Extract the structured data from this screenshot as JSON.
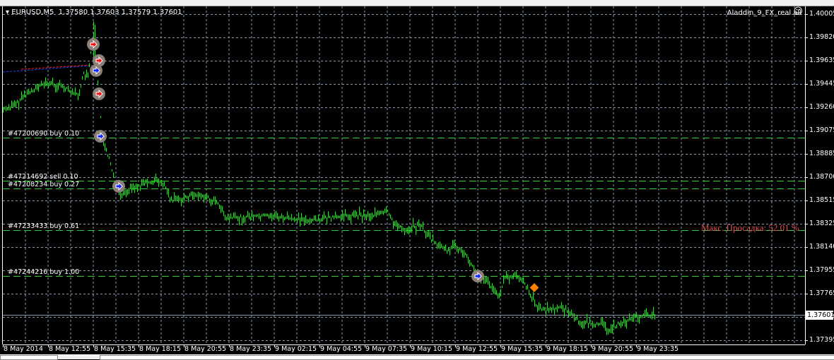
{
  "toolbar": {},
  "header": {
    "symbol": "EURUSD,M5",
    "ohlc": "1.37580 1.37603 1.37579 1.37601",
    "expert": "Aladdin_9_FX_real all",
    "expert_icon": "smiley-icon"
  },
  "drawdown_label": "Макс. Просадка: 52.01 %",
  "current_price": "1.37601",
  "orders": [
    {
      "label": "#47200690 buy 0.10",
      "price": 1.39016
    },
    {
      "label": "#47214692 sell 0.10",
      "price": 1.38672
    },
    {
      "label": "#47208234 buy 0.27",
      "price": 1.3861
    },
    {
      "label": "#47233433 buy 0.61",
      "price": 1.38276
    },
    {
      "label": "#47244216 buy 1.00",
      "price": 1.37909
    }
  ],
  "colors": {
    "bars": "#00ff00",
    "grid": "#8899aa",
    "orders": "#32cd32",
    "drawdown": "#e05050",
    "current": "#8899aa"
  },
  "chart_data": {
    "type": "line",
    "title": "EURUSD,M5",
    "ylim": [
      1.37395,
      1.40005
    ],
    "y_ticks": [
      "1.40005",
      "1.39820",
      "1.39635",
      "1.39445",
      "1.39260",
      "1.39075",
      "1.38885",
      "1.38700",
      "1.38515",
      "1.38325",
      "1.38140",
      "1.37955",
      "1.37765",
      "1.37580",
      "1.37395"
    ],
    "x_ticks": [
      "8 May 2014",
      "8 May 12:55",
      "8 May 15:35",
      "8 May 18:15",
      "8 May 20:55",
      "8 May 23:35",
      "9 May 02:15",
      "9 May 04:55",
      "9 May 07:35",
      "9 May 10:15",
      "9 May 12:55",
      "9 May 15:35",
      "9 May 18:15",
      "9 May 20:55",
      "9 May 23:35"
    ],
    "x_unit": "bars (M5) from start",
    "series": [
      {
        "name": "EURUSD close",
        "x": [
          0,
          8,
          15,
          23,
          30,
          38,
          45,
          53,
          57,
          60,
          64,
          65,
          68,
          70,
          75,
          80,
          83,
          88,
          98,
          108,
          115,
          118,
          128,
          135,
          145,
          153,
          157,
          168,
          188,
          203,
          218,
          233,
          248,
          263,
          272,
          278,
          285,
          295,
          303,
          313,
          320,
          328,
          335,
          343,
          350,
          355,
          363,
          370,
          378,
          385,
          393,
          400,
          407,
          415,
          423,
          429,
          436,
          443,
          452,
          462
        ],
        "y": [
          1.39242,
          1.3927,
          1.39355,
          1.39412,
          1.39451,
          1.3944,
          1.39412,
          1.39355,
          1.39525,
          1.39497,
          1.39892,
          1.3961,
          1.39355,
          1.39016,
          1.38847,
          1.38621,
          1.38564,
          1.38604,
          1.38638,
          1.38677,
          1.38621,
          1.38508,
          1.38536,
          1.38564,
          1.38536,
          1.3848,
          1.38367,
          1.38378,
          1.38395,
          1.38367,
          1.38355,
          1.38378,
          1.38395,
          1.38395,
          1.38423,
          1.3831,
          1.38282,
          1.38321,
          1.38197,
          1.38112,
          1.3814,
          1.38084,
          1.37915,
          1.37858,
          1.37745,
          1.37886,
          1.37915,
          1.3783,
          1.3766,
          1.37632,
          1.3766,
          1.37632,
          1.37547,
          1.3753,
          1.37519,
          1.37474,
          1.3753,
          1.37564,
          1.37587,
          1.37601
        ]
      }
    ],
    "trade_markers": [
      {
        "type": "sell",
        "x": 64,
        "y": 1.39763
      },
      {
        "type": "close",
        "x": 68,
        "y": 1.39633
      },
      {
        "type": "buy",
        "x": 66,
        "y": 1.39554
      },
      {
        "type": "sell",
        "x": 68,
        "y": 1.39367
      },
      {
        "type": "buy",
        "x": 69,
        "y": 1.39027
      },
      {
        "type": "buy",
        "x": 82,
        "y": 1.38627
      },
      {
        "type": "buy",
        "x": 336,
        "y": 1.37908
      },
      {
        "type": "pending",
        "x": 376,
        "y": 1.37812
      }
    ],
    "grid": true
  }
}
